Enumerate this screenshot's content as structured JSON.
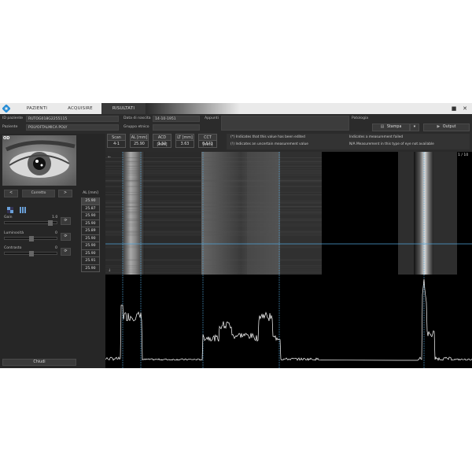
{
  "tabs": [
    {
      "label": "PAZIENTI"
    },
    {
      "label": "ACQUISIRE"
    },
    {
      "label": "RISULTATI"
    }
  ],
  "header": {
    "patient_id_label": "ID paziente",
    "patient_id": "RUTOG018G2255115",
    "patient_label": "Paziente",
    "patient_name": "POLYOFTALMICA POLY",
    "birth_label": "Data di nascita",
    "birth_date": "14-10-1951",
    "ethnic_label": "Gruppo etnico",
    "ethnic_value": "",
    "notes_label": "Appunti",
    "notes_value": "",
    "pathology_label": "Patologia",
    "print_label": "Stampa",
    "output_label": "Output"
  },
  "eye_label": "OD",
  "eye_nav": {
    "prev": "<",
    "current": "Corretto",
    "next": ">"
  },
  "controls": {
    "gain_label": "Gain",
    "gain_value": "1.0",
    "brightness_label": "Luminosità",
    "brightness_value": "0",
    "contrast_label": "Contrasto",
    "contrast_value": "0",
    "gain_pct": 0.88,
    "brightness_pct": 0.5,
    "contrast_pct": 0.5
  },
  "close_label": "Chiudi",
  "al_table": {
    "header": "AL [mm]",
    "values": [
      "25.90",
      "25.87",
      "25.90",
      "25.90",
      "25.89",
      "25.90",
      "25.90",
      "25.90",
      "25.91",
      "25.90"
    ],
    "selected_index": 0
  },
  "measurements": {
    "columns": [
      {
        "header": "Scan",
        "value": "4-1"
      },
      {
        "header": "AL [mm]",
        "value": "25.90"
      },
      {
        "header": "ACD [mm]",
        "value": "3.50"
      },
      {
        "header": "LT [mm]",
        "value": "3.63"
      },
      {
        "header": "CCT [mm]",
        "value": "0.571"
      }
    ]
  },
  "legend": {
    "edited": "(*) Indicates that this value has been edited",
    "uncertain": "(!) Indicates an uncertain measurement value",
    "failed": "Indicates a measurement failed",
    "na": "N/A Measurement in this type of eye not available"
  },
  "scan_counter": "1 / 10",
  "colors": {
    "accent": "#1e90c8",
    "guide": "#4fa3d8",
    "trace": "#ffffff"
  }
}
